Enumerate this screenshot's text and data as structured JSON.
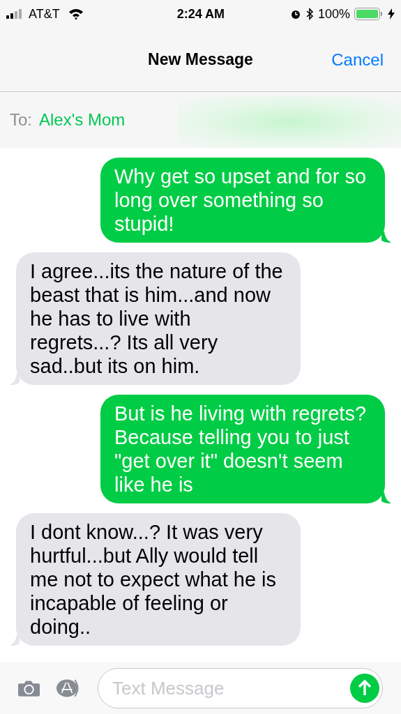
{
  "status_bar": {
    "carrier": "AT&T",
    "time": "2:24 AM",
    "battery": "100%"
  },
  "header": {
    "title": "New Message",
    "cancel": "Cancel"
  },
  "recipient": {
    "label": "To:",
    "name": "Alex's Mom"
  },
  "messages": [
    {
      "kind": "sent",
      "text": "Why get so upset and for so long over something so stupid!"
    },
    {
      "kind": "received",
      "text": "I agree...its the nature of the beast that is him...and now he has to live with regrets...? Its all very sad..but its on him."
    },
    {
      "kind": "sent",
      "text": "But is he living with regrets? Because telling you to just \"get over it\" doesn't seem like he is"
    },
    {
      "kind": "received",
      "text": "I dont know...?  It was very hurtful...but Ally would tell me not to expect what he is incapable of feeling or doing.."
    }
  ],
  "compose": {
    "placeholder": "Text Message"
  }
}
